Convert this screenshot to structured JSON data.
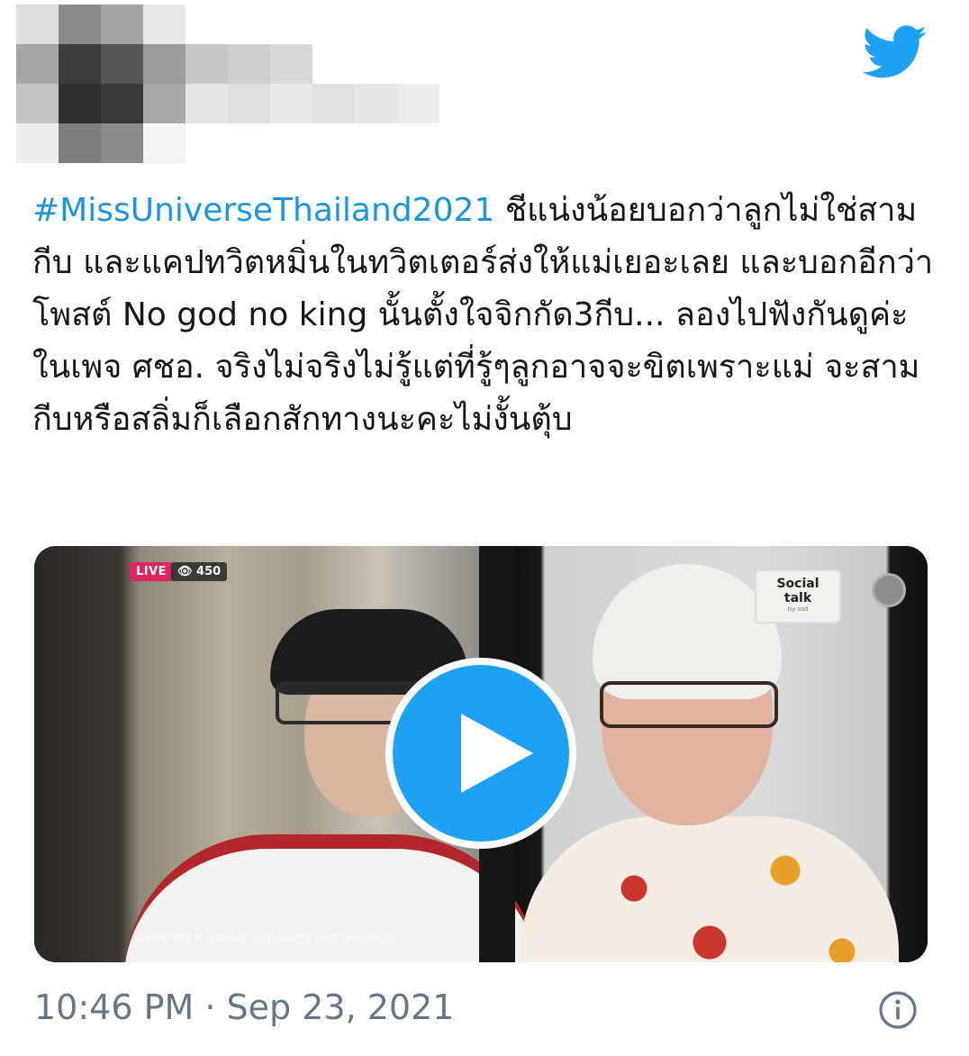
{
  "tweet": {
    "hashtag": "#MissUniverseThailand2021",
    "body": " ชีแน่งน้อยบอกว่าลูกไม่ใช่สามกีบ และแคปทวิตหมิ่นในทวิตเตอร์ส่งให้แม่เยอะเลย และบอกอีกว่าโพสต์ No god no king นั้นตั้งใจจิกกัด3กีบ... ลองไปฟังกันดูค่ะในเพจ ศชอ. จริงไม่จริงไม่รู้แต่ที่รู้ๆลูกอาจจะขิตเพราะแม่ จะสามกีบหรือสลิ่มก็เลือกสักทางนะคะไม่งั้นตุ้บ",
    "timestamp": "10:46 PM · Sep 23, 2021"
  },
  "media": {
    "live_label": "LIVE",
    "viewer_count": "👁 450",
    "logo_line1": "Social",
    "logo_line2": "talk",
    "logo_sub": "by ssd",
    "swipe_hint": "Swipe left to reveal comments and reactions"
  },
  "icons": {
    "brand": "twitter-bird-icon",
    "play": "play-icon",
    "info": "info-icon"
  },
  "colors": {
    "twitter_blue": "#1da1f2",
    "hashtag_blue": "#1b95e0",
    "meta_gray": "#657786",
    "live_red": "#e0245e"
  }
}
